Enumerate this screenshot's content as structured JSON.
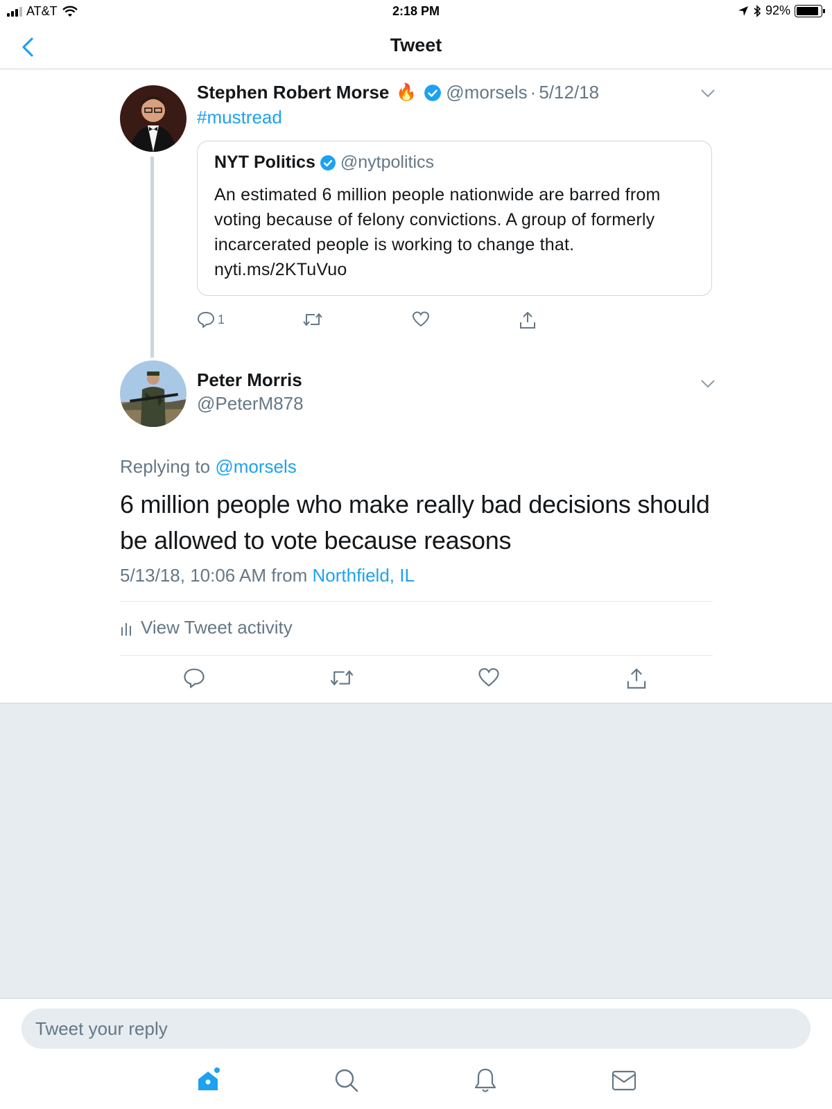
{
  "status_bar": {
    "carrier": "AT&T",
    "time": "2:18 PM",
    "battery": "92%",
    "battery_level": 0.92
  },
  "nav": {
    "title": "Tweet"
  },
  "tweet1": {
    "name": "Stephen Robert Morse",
    "name_emoji": "🔥",
    "handle": "@morsels",
    "separator": "·",
    "date": "5/12/18",
    "text": "#mustread",
    "quote": {
      "name": "NYT Politics",
      "handle": "@nytpolitics",
      "text": "An estimated 6 million people nationwide are barred from voting because of felony convictions. A group of formerly incarcerated people is working to change that. nyti.ms/2KTuVuo"
    },
    "reply_count": "1"
  },
  "tweet2": {
    "name": "Peter Morris",
    "handle": "@PeterM878",
    "replying_prefix": "Replying to",
    "replying_to": "@morsels",
    "text": "6 million people who make really bad decisions should be allowed to vote because reasons",
    "timestamp": "5/13/18, 10:06 AM from",
    "location": "Northfield, IL",
    "activity_label": "View Tweet activity"
  },
  "reply": {
    "placeholder": "Tweet your reply"
  },
  "tabs": [
    "home-icon",
    "search-icon",
    "notifications-icon",
    "messages-icon"
  ],
  "colors": {
    "accent": "#1da1f2",
    "muted": "#657786",
    "border": "#ccd6dd",
    "background_gray": "#e6ecf0"
  }
}
